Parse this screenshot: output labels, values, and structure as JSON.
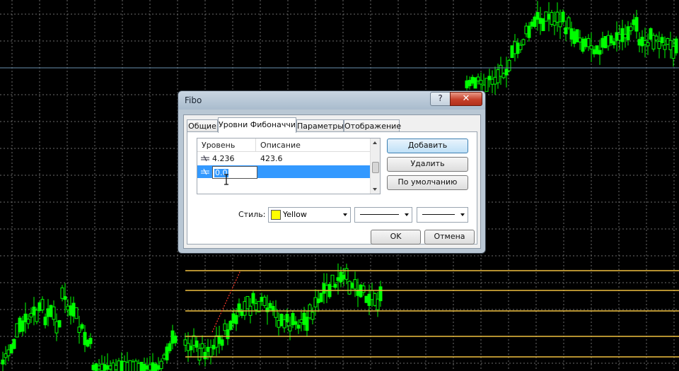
{
  "chart": {
    "background": "#000000",
    "grid_color": "#6b6b6b",
    "candle_color": "#00ff00",
    "fib_line_color": "#f0c040",
    "hline_color": "#6a8fb0",
    "cursor_icon": "text-cursor-icon"
  },
  "dialog": {
    "title": "Fibo",
    "minimize_glyph": "?",
    "close_glyph": "✕",
    "tabs": [
      {
        "label": "Общие",
        "active": false
      },
      {
        "label": "Уровни Фибоначчи",
        "active": true
      },
      {
        "label": "Параметры",
        "active": false
      },
      {
        "label": "Отображение",
        "active": false
      }
    ],
    "levels_table": {
      "headers": [
        "Уровень",
        "Описание"
      ],
      "rows": [
        {
          "level": "4.236",
          "description": "423.6",
          "selected": false
        },
        {
          "level": "0.0",
          "description": "",
          "selected": true,
          "editing": true
        }
      ]
    },
    "buttons": {
      "add": "Добавить",
      "delete": "Удалить",
      "default": "По умолчанию",
      "ok": "OK",
      "cancel": "Отмена"
    },
    "style": {
      "label": "Стиль:",
      "color_name": "Yellow",
      "color_value": "#ffff00"
    }
  }
}
